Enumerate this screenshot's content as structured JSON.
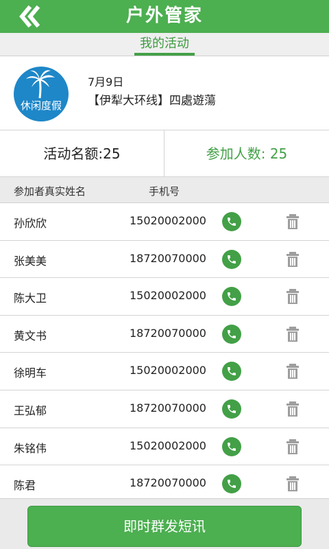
{
  "header": {
    "title": "户外管家",
    "back_icon": "double-chevron-left-icon"
  },
  "tabs": {
    "active_label": "我的活动"
  },
  "event": {
    "logo_text": "休闲度假",
    "date": "7月9日",
    "name": "【伊犁大环线】四處遊蕩"
  },
  "stats": {
    "quota_label": "活动名额:25",
    "joined_label": "参加人数: 25"
  },
  "list": {
    "col_name": "参加者真实姓名",
    "col_phone": "手机号",
    "participants": [
      {
        "name": "孙欣欣",
        "phone": "15020002000"
      },
      {
        "name": "张美美",
        "phone": "18720070000"
      },
      {
        "name": "陈大卫",
        "phone": "15020002000"
      },
      {
        "name": "黄文书",
        "phone": "18720070000"
      },
      {
        "name": "徐明车",
        "phone": "15020002000"
      },
      {
        "name": "王弘郁",
        "phone": "18720070000"
      },
      {
        "name": "朱铭伟",
        "phone": "15020002000"
      },
      {
        "name": "陈君",
        "phone": "18720070000"
      }
    ]
  },
  "footer": {
    "sms_button_label": "即时群发短讯"
  },
  "colors": {
    "primary": "#4caf50",
    "logo_bg": "#1e87c8",
    "text": "#222222"
  }
}
